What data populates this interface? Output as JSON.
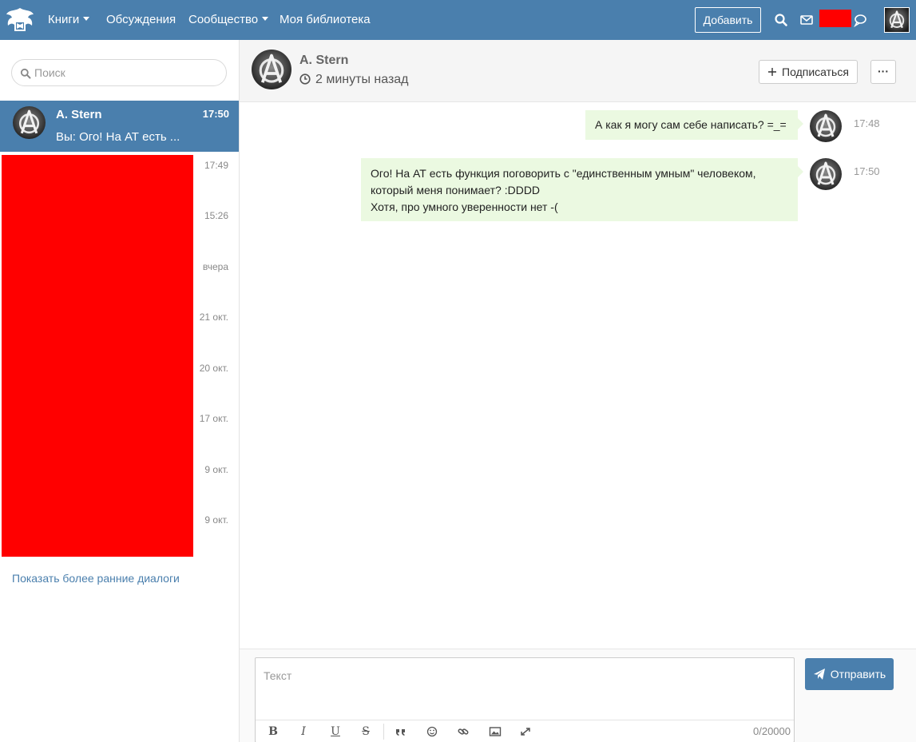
{
  "colors": {
    "accent": "#4a7fad",
    "redaction": "#ff0000",
    "bubble": "#ebf9e1"
  },
  "nav": {
    "books": "Книги",
    "discussions": "Обсуждения",
    "community": "Сообщество",
    "library": "Моя библиотека",
    "add": "Добавить",
    "icons": [
      "search-icon",
      "envelope-icon",
      "chat-bubble-icon",
      "user-avatar"
    ]
  },
  "sidebar": {
    "search_placeholder": "Поиск",
    "active_dialog": {
      "name": "A. Stern",
      "time": "17:50",
      "preview": "Вы: Ого! На АТ есть ..."
    },
    "dialog_times": [
      "17:49",
      "15:26",
      "вчера",
      "21 окт.",
      "20 окт.",
      "17 окт.",
      "9 окт.",
      "9 окт."
    ],
    "show_more": "Показать более ранние диалоги"
  },
  "chat": {
    "name": "A. Stern",
    "status": "2 минуты назад",
    "subscribe": "Подписаться",
    "more": "···"
  },
  "messages": [
    {
      "text": "А как я могу сам себе написать? =_=",
      "time": "17:48"
    },
    {
      "lines": [
        "Ого! На АТ есть функция поговорить с \"единственным умным\" человеком,",
        "который меня понимает? :DDDD",
        "Хотя, про умного уверенности нет -("
      ],
      "time": "17:50"
    }
  ],
  "composer": {
    "placeholder": "Текст",
    "counter": "0/20000",
    "send": "Отправить",
    "tools": {
      "bold": "B",
      "italic": "I",
      "underline": "U",
      "strike": "S"
    }
  }
}
